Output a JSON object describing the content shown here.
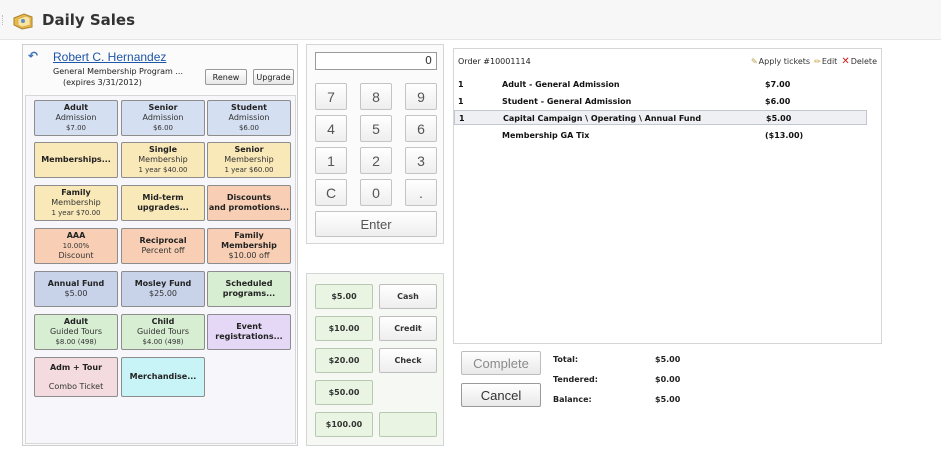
{
  "title": "Daily Sales",
  "customer": {
    "name": "Robert C. Hernandez",
    "program": "General Membership Program ...",
    "expires": "(expires 3/31/2012)",
    "renew_label": "Renew",
    "upgrade_label": "Upgrade"
  },
  "tiles": [
    {
      "l1": "Adult",
      "l2": "Admission",
      "l3": "$7.00"
    },
    {
      "l1": "Senior",
      "l2": "Admission",
      "l3": "$6.00"
    },
    {
      "l1": "Student",
      "l2": "Admission",
      "l3": "$6.00"
    },
    {
      "l1": "Memberships...",
      "l2": "",
      "l3": ""
    },
    {
      "l1": "Single",
      "l2": "Membership",
      "l3": "1 year $40.00"
    },
    {
      "l1": "Senior",
      "l2": "Membership",
      "l3": "1 year $60.00"
    },
    {
      "l1": "Family",
      "l2": "Membership",
      "l3": "1 year $70.00"
    },
    {
      "l1": "Mid-term",
      "l2": "upgrades...",
      "l3": ""
    },
    {
      "l1": "Discounts",
      "l2": "and promotions...",
      "l3": ""
    },
    {
      "l1": "AAA",
      "l2": "10.00%",
      "l3": "Discount"
    },
    {
      "l1": "Reciprocal",
      "l2": "Percent off",
      "l3": ""
    },
    {
      "l1": "Family Membership",
      "l2": "$10.00 off",
      "l3": ""
    },
    {
      "l1": "Annual Fund",
      "l2": "$5.00",
      "l3": ""
    },
    {
      "l1": "Mosley Fund",
      "l2": "$25.00",
      "l3": ""
    },
    {
      "l1": "Scheduled",
      "l2": "programs...",
      "l3": ""
    },
    {
      "l1": "Adult",
      "l2": "Guided Tours",
      "l3": "$8.00 (498)"
    },
    {
      "l1": "Child",
      "l2": "Guided Tours",
      "l3": "$4.00 (498)"
    },
    {
      "l1": "Event",
      "l2": "registrations...",
      "l3": ""
    },
    {
      "l1": "Adm + Tour",
      "l2": "Combo Ticket",
      "l3": ""
    },
    {
      "l1": "Merchandise...",
      "l2": "",
      "l3": ""
    }
  ],
  "keypad": {
    "display": "0",
    "keys": [
      "7",
      "8",
      "9",
      "4",
      "5",
      "6",
      "1",
      "2",
      "3",
      "C",
      "0",
      "."
    ],
    "enter": "Enter"
  },
  "payment": {
    "amounts": [
      "$5.00",
      "$10.00",
      "$20.00",
      "$50.00",
      "$100.00"
    ],
    "methods": [
      "Cash",
      "Credit",
      "Check"
    ]
  },
  "order": {
    "number": "Order #10001114",
    "apply_tickets": "Apply tickets",
    "edit": "Edit",
    "delete": "Delete",
    "lines": [
      {
        "qty": "1",
        "desc": "Adult - General Admission",
        "price": "$7.00"
      },
      {
        "qty": "1",
        "desc": "Student - General Admission",
        "price": "$6.00"
      },
      {
        "qty": "1",
        "desc": "Capital Campaign \\ Operating \\ Annual Fund",
        "price": "$5.00"
      },
      {
        "qty": "",
        "desc": "Membership GA Tix",
        "price": "($13.00)"
      }
    ]
  },
  "actions": {
    "complete": "Complete",
    "cancel": "Cancel"
  },
  "totals": {
    "total_label": "Total:",
    "total": "$5.00",
    "tendered_label": "Tendered:",
    "tendered": "$0.00",
    "balance_label": "Balance:",
    "balance": "$5.00"
  }
}
